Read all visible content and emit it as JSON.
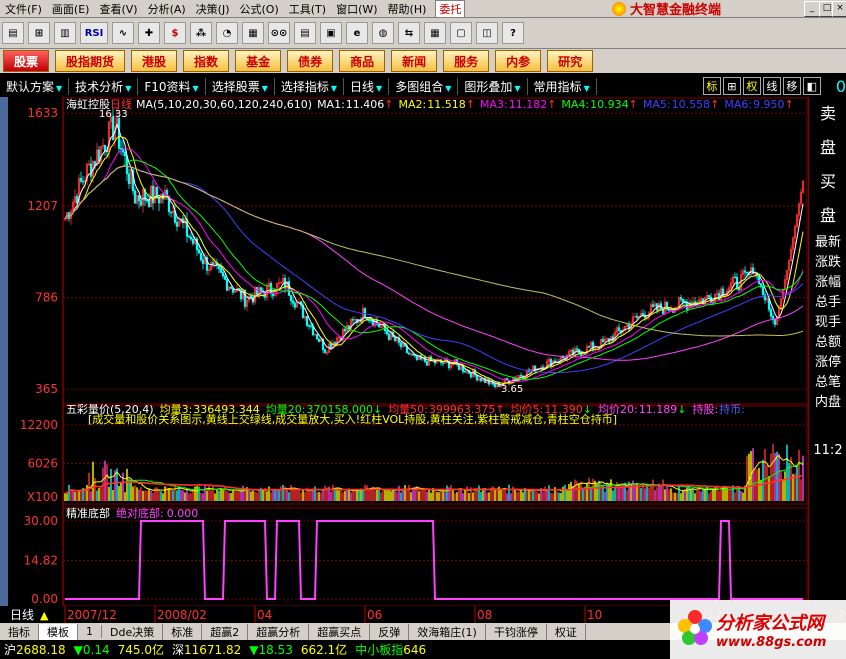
{
  "menu": {
    "items": [
      "文件(F)",
      "画面(E)",
      "查看(V)",
      "分析(A)",
      "决策(J)",
      "公式(O)",
      "工具(T)",
      "窗口(W)",
      "帮助(H)"
    ],
    "weituo": "委托",
    "brand": "大智慧金融终端"
  },
  "toolbar": {
    "rsi": "RSI",
    "dollar": "$"
  },
  "nav": [
    "股票",
    "股指期货",
    "港股",
    "指数",
    "基金",
    "债券",
    "商品",
    "新闻",
    "服务",
    "内参",
    "研究"
  ],
  "subbar": {
    "items": [
      "默认方案",
      "技术分析",
      "F10资料",
      "选择股票",
      "选择指标",
      "日线",
      "多图组合",
      "图形叠加",
      "常用指标"
    ],
    "toggles": [
      "标",
      "⊞",
      "权",
      "线",
      "移",
      "◧"
    ],
    "zero": "0"
  },
  "colors": {
    "ma1": "#ffffff",
    "ma2": "#ffff00",
    "ma3": "#ff00ff",
    "ma4": "#00ff00",
    "ma5": "#4040ff",
    "ma6": "#ff40ff",
    "up": "#ff3030",
    "down": "#00ffff",
    "pink": "#ff40ff"
  },
  "panel1": {
    "stock": "海虹控股",
    "period": "日线",
    "ma_label": "MA(5,10,20,30,60,120,240,610)",
    "ma": [
      {
        "name": "MA1:",
        "value": "11.406"
      },
      {
        "name": "MA2:",
        "value": "11.518"
      },
      {
        "name": "MA3:",
        "value": "11.182"
      },
      {
        "name": "MA4:",
        "value": "10.934"
      },
      {
        "name": "MA5:",
        "value": "10.558"
      },
      {
        "name": "MA6:",
        "value": "9.950"
      }
    ],
    "y_ticks": [
      "1633",
      "1207",
      "786",
      "365"
    ],
    "high_label": "16.33",
    "low_label": "3.65"
  },
  "panel2": {
    "title": "五彩量价(5,20,4)",
    "items": [
      {
        "name": "均量3:",
        "value": "336493.344"
      },
      {
        "name": "均量20:",
        "value": "370158.000"
      },
      {
        "name": "均量50:",
        "value": "399963.375"
      },
      {
        "name": "均价5:",
        "value": "11.390"
      },
      {
        "name": "均价20:",
        "value": "11.189"
      },
      {
        "name": "持股:",
        "value": "持币:"
      }
    ],
    "note": "[成交量和股价关系图示,黄线上交绿线,成交量放大,买入!红柱VOL持股,黄柱关注,紫柱警戒减仓,青柱空仓持币]",
    "y_ticks": [
      "12200",
      "6026",
      "X100"
    ]
  },
  "panel3": {
    "title": "精准底部",
    "label": "绝对底部:",
    "value": "0.000",
    "y_ticks": [
      "30.00",
      "14.82",
      "0.00"
    ]
  },
  "xaxis": {
    "labels": [
      "2007/12",
      "2008/02",
      "04",
      "06",
      "08",
      "10",
      "12",
      "2009/02",
      "04",
      "06"
    ],
    "period": "日线"
  },
  "rightpanel": {
    "top": [
      "卖",
      "盘",
      "买",
      "盘"
    ],
    "list": [
      "最新",
      "涨跌",
      "涨幅",
      "总手",
      "现手",
      "总额",
      "涨停",
      "总笔",
      "内盘"
    ],
    "time": "11:2"
  },
  "tabs": [
    "指标",
    "模板",
    "1",
    "Dde决策",
    "标准",
    "超赢2",
    "超赢分析",
    "超赢买点",
    "反弹",
    "效海箱庄(1)",
    "干钧涨停",
    "权证"
  ],
  "status": [
    {
      "label": "沪",
      "value": "2688.18"
    },
    {
      "label": "▼",
      "value": "0.14"
    },
    {
      "label": "",
      "value": "745.0亿"
    },
    {
      "label": "深",
      "value": "11671.82"
    },
    {
      "label": "▼",
      "value": "18.53"
    },
    {
      "label": "",
      "value": "662.1亿"
    },
    {
      "label": "中小板指",
      "value": "646"
    }
  ],
  "watermark": {
    "title": "分析家公式网",
    "url": "www.88gs.com"
  }
}
